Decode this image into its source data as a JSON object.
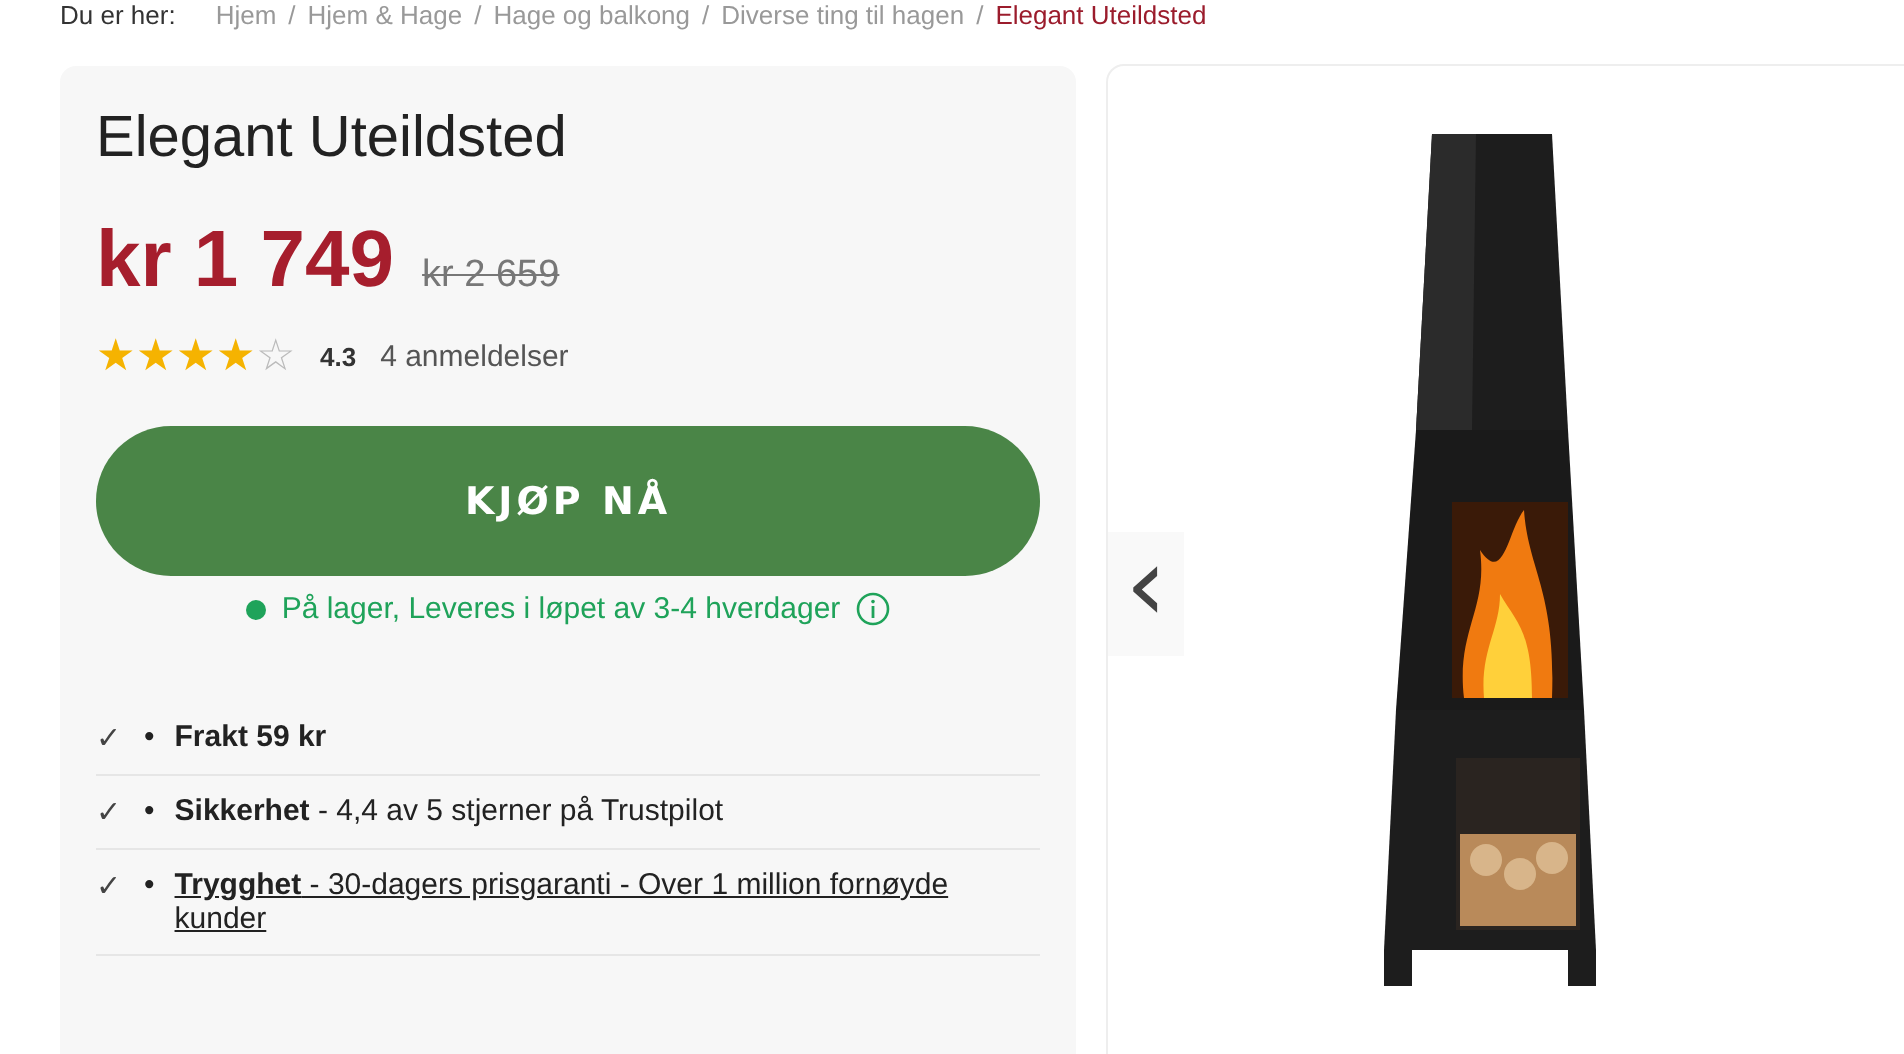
{
  "breadcrumb": {
    "label": "Du er her:",
    "separator": "/",
    "items": [
      {
        "text": "Hjem",
        "current": false
      },
      {
        "text": "Hjem & Hage",
        "current": false
      },
      {
        "text": "Hage og balkong",
        "current": false
      },
      {
        "text": "Diverse ting til hagen",
        "current": false
      },
      {
        "text": "Elegant Uteildsted",
        "current": true
      }
    ]
  },
  "product": {
    "title": "Elegant Uteildsted",
    "price": "kr 1 749",
    "old_price": "kr 2 659",
    "stars": 4,
    "rating": "4.3",
    "reviews": "4 anmeldelser",
    "buy_button": "KJØP NÅ",
    "stock": {
      "text": "På lager, Leveres i løpet av 3-4 hverdager",
      "color": "#1fa35a"
    }
  },
  "features": [
    {
      "kind": "text",
      "check": "✓",
      "bullet": "•",
      "text": "**Frakt 59 kr**"
    },
    {
      "kind": "text",
      "check": "✓",
      "bullet": "•",
      "text": "**Sikkerhet** - 4,4 av 5 stjerner på Trustpilot"
    },
    {
      "kind": "link",
      "check": "✓",
      "bullet": "•",
      "text": "**Trygghet** - 30-dagers prisgaranti - Over 1 million fornøyde kunder"
    }
  ],
  "gallery": {
    "prev": "‹"
  }
}
